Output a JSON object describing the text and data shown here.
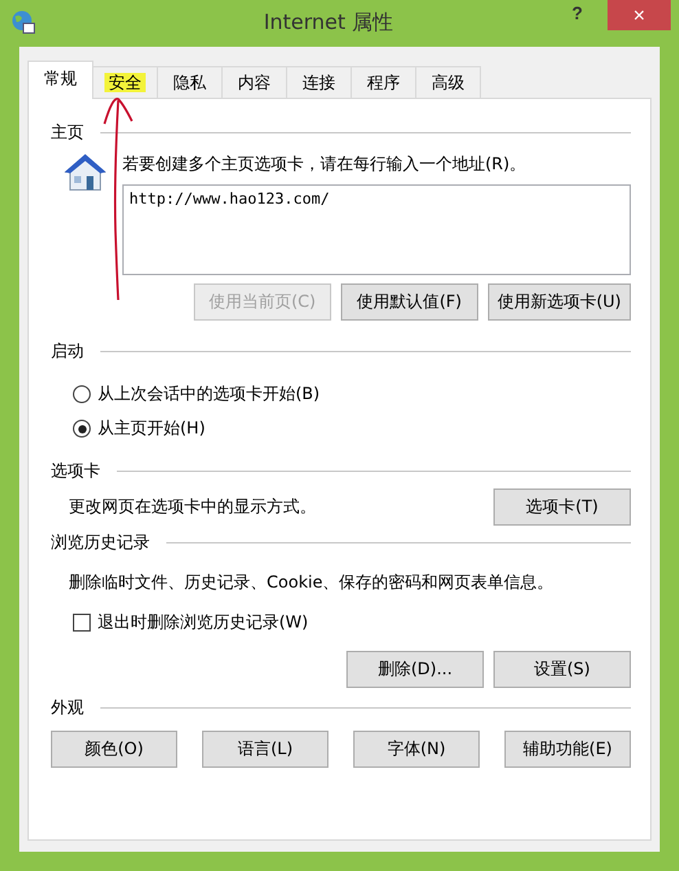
{
  "window": {
    "title": "Internet 属性",
    "help": "?",
    "close": "×"
  },
  "tabs": [
    {
      "label": "常规",
      "selected": true,
      "highlighted": false
    },
    {
      "label": "安全",
      "selected": false,
      "highlighted": true
    },
    {
      "label": "隐私",
      "selected": false,
      "highlighted": false
    },
    {
      "label": "内容",
      "selected": false,
      "highlighted": false
    },
    {
      "label": "连接",
      "selected": false,
      "highlighted": false
    },
    {
      "label": "程序",
      "selected": false,
      "highlighted": false
    },
    {
      "label": "高级",
      "selected": false,
      "highlighted": false
    }
  ],
  "home_page": {
    "heading": "主页",
    "instruction": "若要创建多个主页选项卡，请在每行输入一个地址(R)。",
    "value": "http://www.hao123.com/",
    "buttons": [
      {
        "label": "使用当前页(C)",
        "disabled": true
      },
      {
        "label": "使用默认值(F)",
        "disabled": false
      },
      {
        "label": "使用新选项卡(U)",
        "disabled": false
      }
    ]
  },
  "startup": {
    "heading": "启动",
    "options": [
      {
        "label": "从上次会话中的选项卡开始(B)",
        "selected": false
      },
      {
        "label": "从主页开始(H)",
        "selected": true
      }
    ]
  },
  "tabs_section": {
    "heading": "选项卡",
    "description": "更改网页在选项卡中的显示方式。",
    "button": "选项卡(T)"
  },
  "history": {
    "heading": "浏览历史记录",
    "description": "删除临时文件、历史记录、Cookie、保存的密码和网页表单信息。",
    "checkbox": {
      "label": "退出时删除浏览历史记录(W)",
      "checked": false
    },
    "buttons": [
      {
        "label": "删除(D)...",
        "disabled": false
      },
      {
        "label": "设置(S)",
        "disabled": false
      }
    ]
  },
  "appearance": {
    "heading": "外观",
    "buttons": [
      {
        "label": "颜色(O)",
        "disabled": false
      },
      {
        "label": "语言(L)",
        "disabled": false
      },
      {
        "label": "字体(N)",
        "disabled": false
      },
      {
        "label": "辅助功能(E)",
        "disabled": false
      }
    ]
  }
}
